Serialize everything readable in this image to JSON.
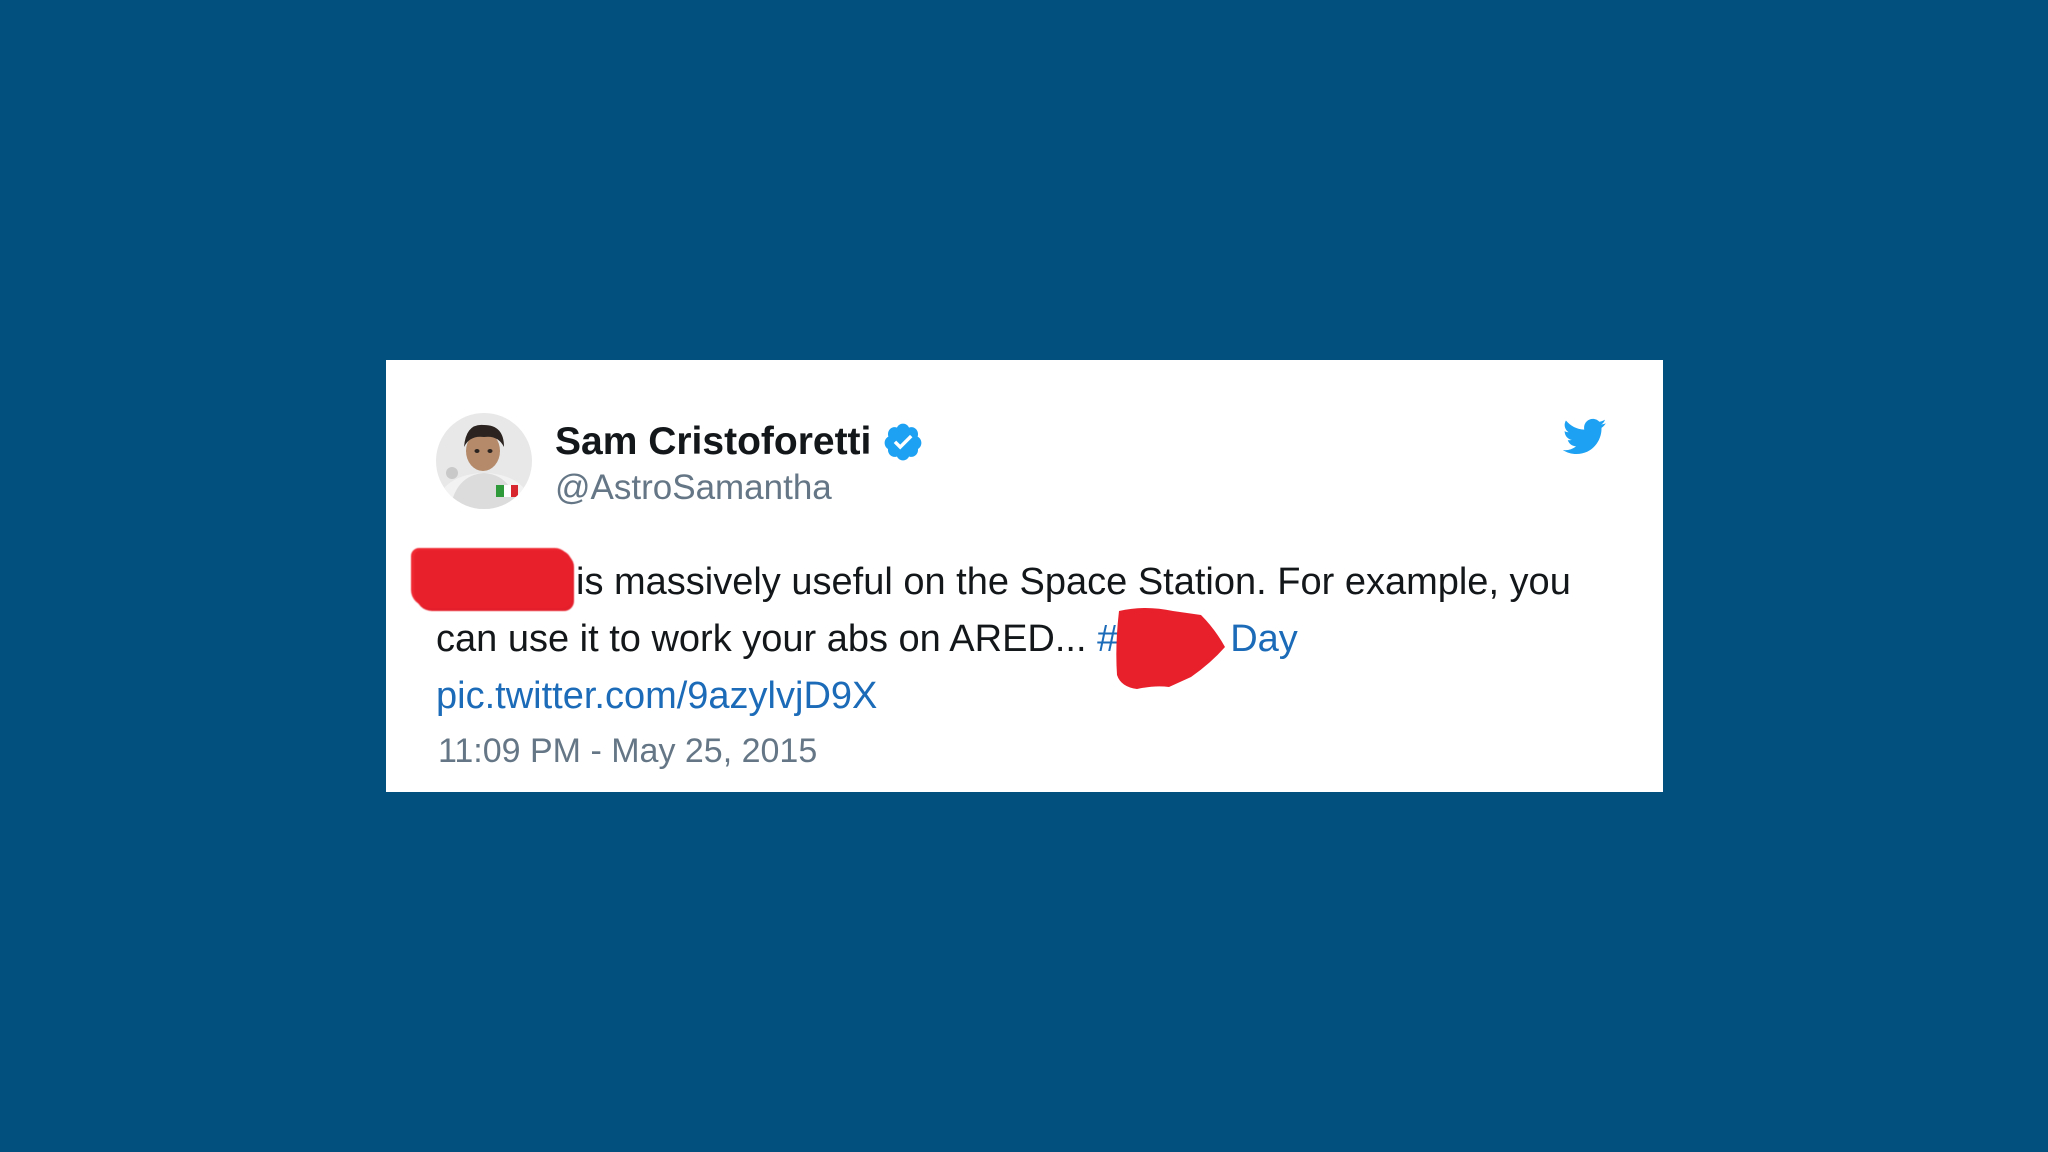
{
  "tweet": {
    "display_name": "Sam Cristoforetti",
    "handle": "@AstroSamantha",
    "text_part_1": "is massively useful on the Space Station. For example, you can use it to work your abs on ARED... ",
    "hashtag_visible_start": "#",
    "hashtag_visible_end": "Day",
    "pic_link": "pic.twitter.com/9azylvjD9X",
    "timestamp": "11:09 PM - May 25, 2015"
  },
  "icons": {
    "verified": "verified-badge-icon",
    "brand": "twitter-bird-icon"
  },
  "colors": {
    "background": "#01507E",
    "card": "#FFFFFF",
    "link": "#1B6BB8",
    "verified": "#1DA1F2",
    "redaction": "#E8202C"
  }
}
